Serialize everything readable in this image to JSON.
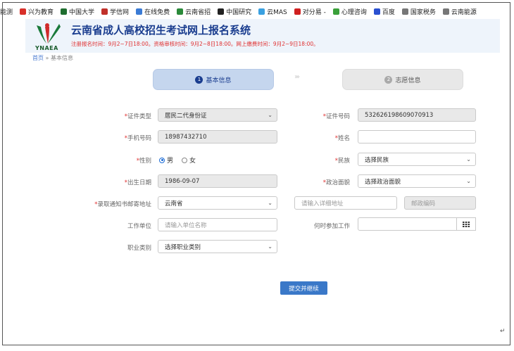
{
  "bookmarks": [
    {
      "label": "能测",
      "color": "#ffffff"
    },
    {
      "label": "兴为教育",
      "color": "#d8302a"
    },
    {
      "label": "中国大学",
      "color": "#1f6e2f"
    },
    {
      "label": "学信网",
      "color": "#c0302a"
    },
    {
      "label": "在线免费",
      "color": "#3a7bd5"
    },
    {
      "label": "云南省招",
      "color": "#2a8a3a"
    },
    {
      "label": "中国研究",
      "color": "#222222"
    },
    {
      "label": "云MAS",
      "color": "#3aa0e0"
    },
    {
      "label": "对分易 -",
      "color": "#d02020"
    },
    {
      "label": "心理咨询",
      "color": "#3aa03a"
    },
    {
      "label": "百度",
      "color": "#2a50d0"
    },
    {
      "label": "国家税务",
      "color": "#777777"
    },
    {
      "label": "云南能源",
      "color": "#777777"
    }
  ],
  "header": {
    "logo_text": "YNAEA",
    "title": "云南省成人高校招生考试网上报名系统",
    "notice": "注册报名时间：9月2~7日18:00。资格审核时间：9月2~8日18:00。网上缴费时间：9月2~9日18:00。"
  },
  "breadcrumb": {
    "home": "首页",
    "sep": "»",
    "current": "基本信息"
  },
  "steps": [
    {
      "num": "1",
      "label": "基本信息"
    },
    {
      "num": "2",
      "label": "志愿信息"
    }
  ],
  "step_arrows": "›››",
  "form": {
    "id_type": {
      "label": "证件类型",
      "value": "居民二代身份证"
    },
    "id_number": {
      "label": "证件号码",
      "value": "532626198609070913"
    },
    "phone": {
      "label": "手机号码",
      "value": "18987432710"
    },
    "name": {
      "label": "姓名",
      "value": ""
    },
    "gender": {
      "label": "性别",
      "male": "男",
      "female": "女",
      "selected": "男"
    },
    "ethnicity": {
      "label": "民族",
      "value": "选择民族"
    },
    "birth": {
      "label": "出生日期",
      "value": "1986-09-07"
    },
    "politics": {
      "label": "政治面貌",
      "value": "选择政治面貌"
    },
    "address": {
      "label": "录取通知书邮寄地址",
      "province": "云南省",
      "detail_placeholder": "请输入详细地址",
      "postcode_placeholder": "邮政编码"
    },
    "work_unit": {
      "label": "工作单位",
      "placeholder": "请输入单位名称"
    },
    "work_start": {
      "label": "何时参加工作",
      "value": ""
    },
    "job_type": {
      "label": "职业类别",
      "value": "选择职业类别"
    }
  },
  "submit_label": "提交并继续",
  "required_mark": "*",
  "corner_mark": "↵"
}
